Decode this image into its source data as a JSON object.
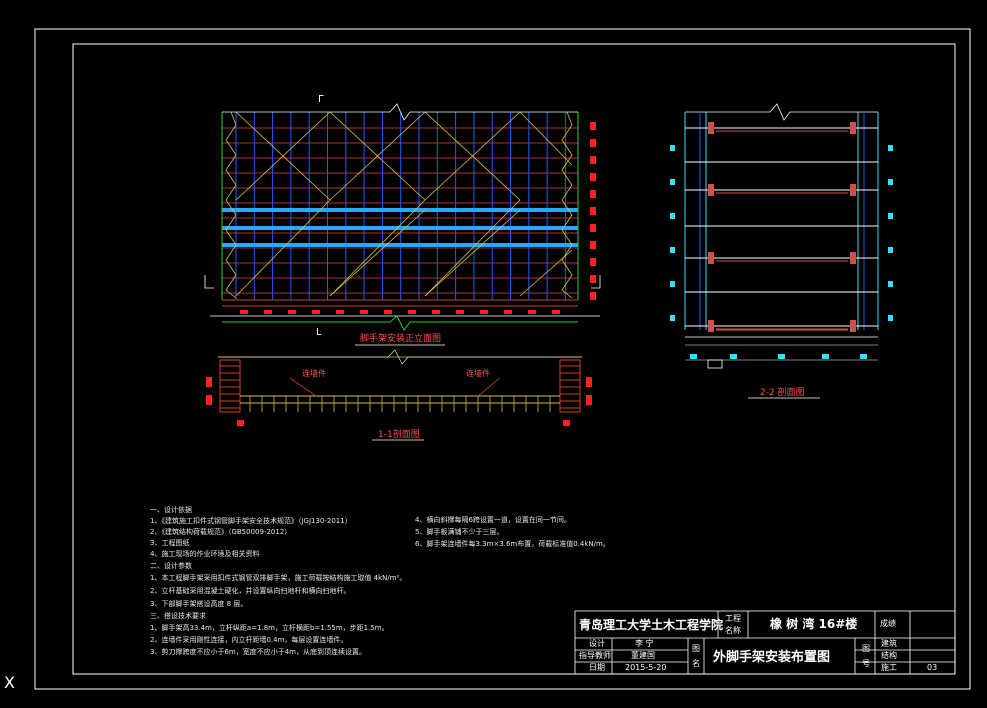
{
  "colors": {
    "background": "#000000",
    "frame": "#ffffff",
    "blue": "#1e5cff",
    "cyan": "#33e0ff",
    "red": "#ff2020",
    "yellow": "#d8c040",
    "green": "#30d030",
    "orange": "#d04020",
    "pink": "#ff5050"
  },
  "elevation": {
    "caption": "脚手架安装正立面图",
    "section_mark_top": "Γ",
    "section_mark_bottom": "L"
  },
  "section_1": {
    "caption": "1-1剖面图",
    "label_left": "连墙件",
    "label_right": "连墙件"
  },
  "section_2": {
    "caption": "2-2 剖面图"
  },
  "notes_left": [
    "一、设计依据",
    "1、《建筑施工扣件式钢管脚手架安全技术规范》（JGJ130-2011）",
    "2、《建筑结构荷载规范》（GB50009-2012）",
    "3、工程图纸",
    "4、施工现场的作业环境及相关资料",
    "二、设计参数",
    "1、本工程脚手架采用扣件式钢管双排脚手架，施工荷载按结构施工取值 4kN/m²。",
    "2、立杆基础采用混凝土硬化，并设置纵向扫地杆和横向扫地杆。",
    "3、下部脚手架搭设高度 8 层。",
    "三、搭设技术要求",
    "1、脚手架高33.4m，立杆纵距a=1.8m，立杆横距b=1.55m，步距1.5m。",
    "2、连墙件采用刚性连接，内立杆距墙0.4m，每层设置连墙件。",
    "3、剪刀撑跨度不应小于6m，宽度不应小于4m，从底到顶连续设置。"
  ],
  "notes_right": [
    "4、横向斜撑每隔6跨设置一道，设置在同一节间。",
    "5、脚手板满铺不少于三层。",
    "6、脚手架连墙件每3.3m×3.6m布置，荷载标准值0.4kN/m。"
  ],
  "title_block": {
    "school": "青岛理工大学土木工程学院",
    "project_label_1": "工程",
    "project_label_2": "名称",
    "project_name": "橡 树 湾 16#楼",
    "grade_label": "成绩",
    "design_label": "设计",
    "design_value": "李 宁",
    "advisor_label": "指导教师",
    "advisor_value": "董建国",
    "date_label": "日期",
    "date_value": "2015-5-20",
    "drawing_label_1": "图",
    "drawing_label_2": "名",
    "drawing_name": "外脚手架安装布置图",
    "number_label_1": "图",
    "number_label_2": "号",
    "arch_label": "建筑",
    "struct_label": "结构",
    "constr_label": "施工",
    "constr_value": "03"
  },
  "corner_mark": "X"
}
